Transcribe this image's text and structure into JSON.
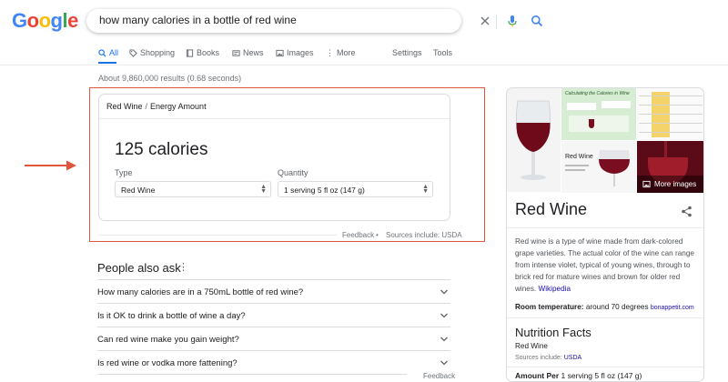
{
  "logo": {
    "letters": [
      "G",
      "o",
      "o",
      "g",
      "l",
      "e"
    ],
    "colors": [
      "#4285F4",
      "#EA4335",
      "#FBBC05",
      "#4285F4",
      "#34A853",
      "#EA4335"
    ]
  },
  "search": {
    "query": "how many calories in a bottle of red wine"
  },
  "tabs": {
    "all": "All",
    "shopping": "Shopping",
    "books": "Books",
    "news": "News",
    "images": "Images",
    "more": "More",
    "settings": "Settings",
    "tools": "Tools"
  },
  "stats": "About 9,860,000 results (0.68 seconds)",
  "card": {
    "crumb_a": "Red Wine",
    "crumb_sep": "/",
    "crumb_b": "Energy Amount",
    "calories": "125 calories",
    "type_label": "Type",
    "type_value": "Red Wine",
    "qty_label": "Quantity",
    "qty_value": "1 serving 5 fl oz (147 g)",
    "feedback": "Feedback",
    "dot": "•",
    "sources": "Sources include: USDA"
  },
  "paa": {
    "title": "People also ask",
    "questions": [
      "How many calories are in a 750mL bottle of red wine?",
      "Is it OK to drink a bottle of wine a day?",
      "Can red wine make you gain weight?",
      "Is red wine or vodka more fattening?"
    ],
    "feedback": "Feedback"
  },
  "kp": {
    "image_title": "Calculating the Calories in Wine",
    "image_label": "Red Wine",
    "more_images": "More images",
    "title": "Red Wine",
    "desc": "Red wine is a type of wine made from dark-colored grape varieties. The actual color of the wine can range from intense violet, typical of young wines, through to brick red for mature wines and brown for older red wines.",
    "wiki": "Wikipedia",
    "temp_label": "Room temperature:",
    "temp_value": "around 70 degrees",
    "temp_src": "bonappetit.com",
    "nf_title": "Nutrition Facts",
    "nf_sub": "Red Wine",
    "nf_src_label": "Sources include:",
    "nf_src": "USDA",
    "amount_label": "Amount Per",
    "amount_value": "1 serving 5 fl oz (147 g)"
  },
  "colors": {
    "accent": "#1a73e8",
    "highlight": "#e0553d",
    "wine": "#7a0d1f"
  }
}
